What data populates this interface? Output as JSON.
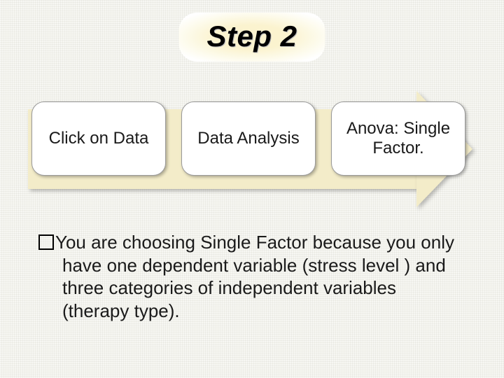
{
  "title": "Step 2",
  "steps": [
    {
      "label": "Click on Data"
    },
    {
      "label": "Data Analysis"
    },
    {
      "label": "Anova: Single Factor."
    }
  ],
  "body": "You are choosing Single Factor because you only have one dependent variable (stress level ) and three categories of independent variables (therapy type)."
}
